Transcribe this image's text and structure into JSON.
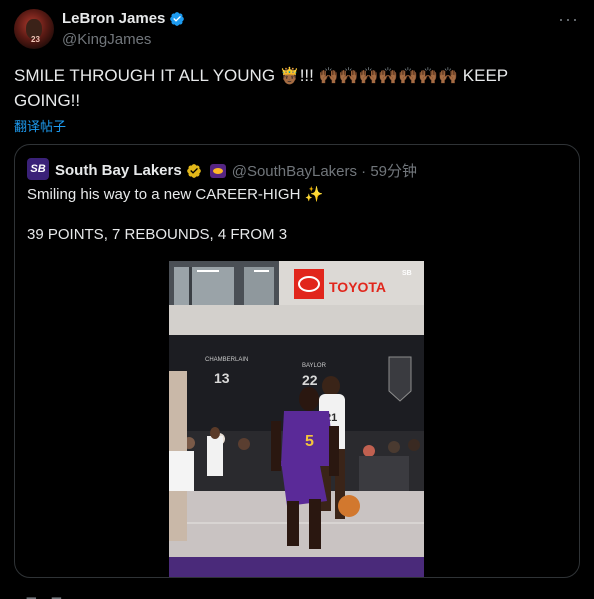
{
  "tweet": {
    "author_name": "LeBron James",
    "author_handle": "@KingJames",
    "avatar_icon": "user-avatar-icon",
    "verified_color": "#1d9bf0",
    "text_main": "SMILE THROUGH IT ALL YOUNG ",
    "text_emoji1": "🤴🏾",
    "text_bang": "!!! ",
    "text_emoji2": "🙌🏾🙌🏾🙌🏾🙌🏾🙌🏾🙌🏾🙌🏾",
    "text_tail": " KEEP GOING!!",
    "translate_label": "翻译帖子",
    "more_label": "···"
  },
  "quote": {
    "avatar_text": "SB",
    "name": "South Bay Lakers",
    "handle_time": "@SouthBayLakers · 59分钟",
    "line1": "Smiling his way to a new CAREER-HIGH ✨",
    "line2": "39 POINTS, 7 REBOUNDS, 4 FROM 3",
    "accent_gold": "#e2b719",
    "lakers_purple": "#552583",
    "media": {
      "banner_brand": "TOYOTA",
      "wall_name1": "CHAMBERLAIN",
      "wall_num1": "13",
      "wall_name2": "BAYLOR",
      "wall_num2": "22",
      "corner_logo": "SB",
      "player_number": "5"
    }
  }
}
